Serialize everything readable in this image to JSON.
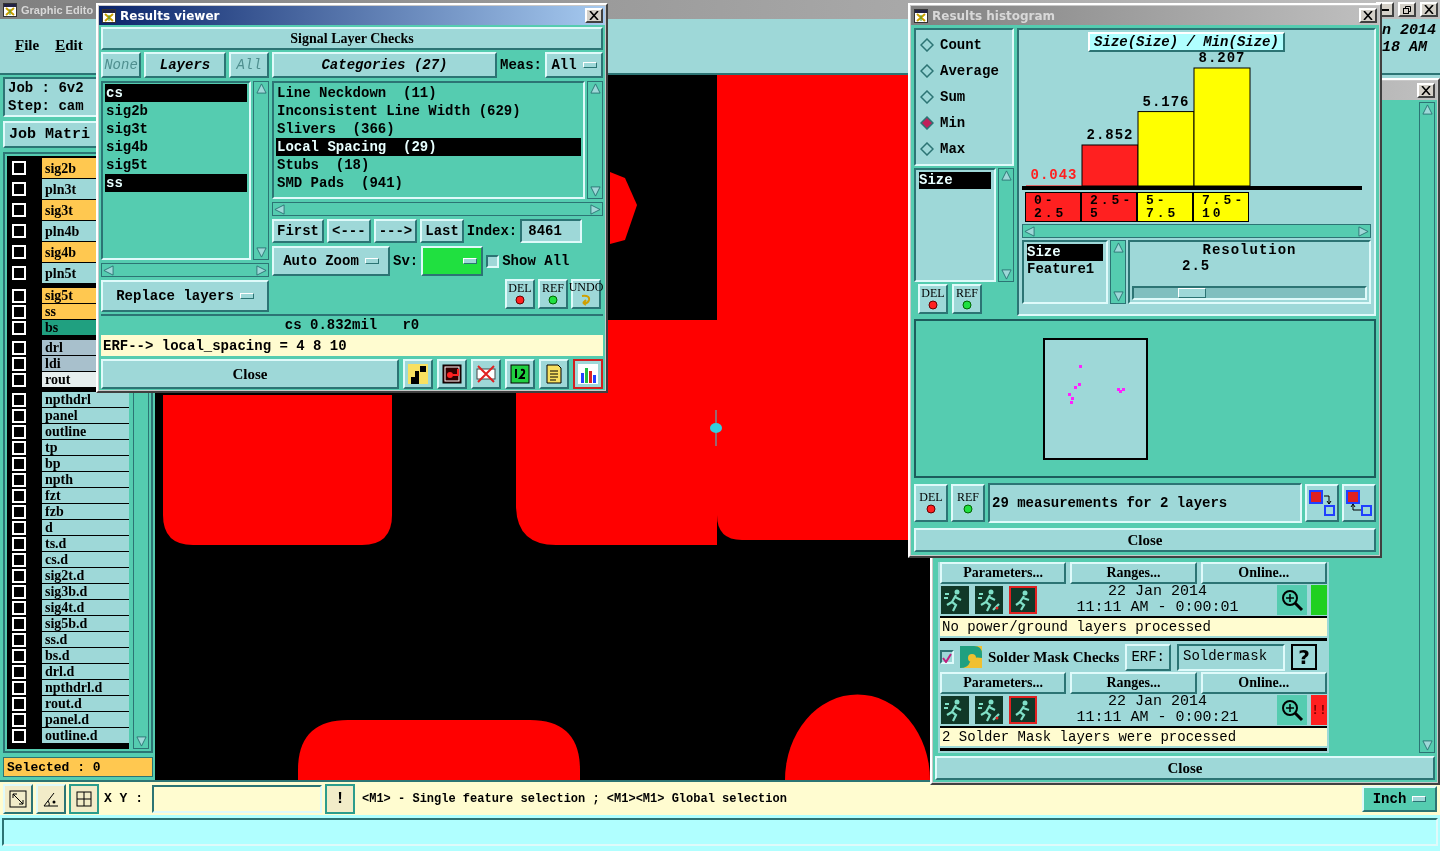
{
  "editor": {
    "title": "Graphic Edito",
    "menu": [
      {
        "label": "File"
      },
      {
        "label": "Edit"
      }
    ],
    "clock": [
      "n 2014",
      "18 AM"
    ],
    "job": "Job  :  6v2",
    "step": "Step:  cam",
    "job_matrix": "Job Matri",
    "layer_groups": [
      {
        "layers": [
          {
            "name": "sig2b",
            "color": "#ffc850",
            "checked": false
          },
          {
            "name": "pln3t",
            "color": "#9ed8d8",
            "checked": false
          },
          {
            "name": "sig3t",
            "color": "#ffc850",
            "checked": false
          },
          {
            "name": "pln4b",
            "color": "#9ed8d8",
            "checked": false
          },
          {
            "name": "sig4b",
            "color": "#ffc850",
            "checked": false
          },
          {
            "name": "pln5t",
            "color": "#9ed8d8",
            "checked": false
          }
        ]
      },
      {
        "layers": [
          {
            "name": "sig5t",
            "color": "#ffc850",
            "checked": false
          },
          {
            "name": "ss",
            "color": "#ffc850",
            "checked": false
          },
          {
            "name": "bs",
            "color": "#20a080",
            "checked": false
          }
        ]
      },
      {
        "layers": [
          {
            "name": "drl",
            "color": "#a8c0cc",
            "checked": false
          },
          {
            "name": "ldi",
            "color": "#a8c0cc",
            "checked": false
          },
          {
            "name": "rout",
            "color": "#e6eeee",
            "checked": false
          }
        ]
      },
      {
        "layers": [
          {
            "name": "npthdrl",
            "color": "#9ed8d8",
            "checked": false
          },
          {
            "name": "panel",
            "color": "#9ed8d8",
            "checked": false
          },
          {
            "name": "outline",
            "color": "#9ed8d8",
            "checked": false
          },
          {
            "name": "tp",
            "color": "#9ed8d8",
            "checked": false
          },
          {
            "name": "bp",
            "color": "#9ed8d8",
            "checked": false
          },
          {
            "name": "npth",
            "color": "#9ed8d8",
            "checked": false
          },
          {
            "name": "fzt",
            "color": "#9ed8d8",
            "checked": false
          },
          {
            "name": "fzb",
            "color": "#9ed8d8",
            "checked": false
          },
          {
            "name": "d",
            "color": "#9ed8d8",
            "checked": false
          },
          {
            "name": "ts.d",
            "color": "#9ed8d8",
            "checked": false
          },
          {
            "name": "cs.d",
            "color": "#9ed8d8",
            "checked": false
          },
          {
            "name": "sig2t.d",
            "color": "#9ed8d8",
            "checked": false
          },
          {
            "name": "sig3b.d",
            "color": "#9ed8d8",
            "checked": false
          },
          {
            "name": "sig4t.d",
            "color": "#9ed8d8",
            "checked": false
          },
          {
            "name": "sig5b.d",
            "color": "#9ed8d8",
            "checked": false
          },
          {
            "name": "ss.d",
            "color": "#9ed8d8",
            "checked": false
          },
          {
            "name": "bs.d",
            "color": "#9ed8d8",
            "checked": false
          },
          {
            "name": "drl.d",
            "color": "#9ed8d8",
            "checked": false
          },
          {
            "name": "npthdrl.d",
            "color": "#9ed8d8",
            "checked": false
          },
          {
            "name": "rout.d",
            "color": "#9ed8d8",
            "checked": false
          },
          {
            "name": "panel.d",
            "color": "#9ed8d8",
            "checked": false
          },
          {
            "name": "outline.d",
            "color": "#9ed8d8",
            "checked": false
          }
        ]
      }
    ],
    "selected_count": "Selected : 0",
    "xy_label": "X Y :",
    "alert_button": "!",
    "hint": "<M1> - Single feature selection ; <M1><M1> Global selection",
    "units": "Inch"
  },
  "results_viewer": {
    "title": "Results viewer",
    "check_name": "Signal Layer Checks",
    "layer_buttons": [
      {
        "label": "None",
        "disabled": true
      },
      {
        "label": "Layers",
        "disabled": false
      },
      {
        "label": "All",
        "disabled": true
      }
    ],
    "layers": [
      {
        "name": "cs",
        "selected": true
      },
      {
        "name": "sig2b",
        "selected": false
      },
      {
        "name": "sig3t",
        "selected": false
      },
      {
        "name": "sig4b",
        "selected": false
      },
      {
        "name": "sig5t",
        "selected": false
      },
      {
        "name": "ss",
        "selected": true
      }
    ],
    "replace_mode": "Replace layers",
    "categories_title": "Categories  (27)",
    "meas_label": "Meas:",
    "meas_value": "All",
    "categories": [
      {
        "label": "Line Neckdown  (11)",
        "selected": false
      },
      {
        "label": "Inconsistent Line Width (629)",
        "selected": false
      },
      {
        "label": "Slivers  (366)",
        "selected": false
      },
      {
        "label": "Local Spacing  (29)",
        "selected": true
      },
      {
        "label": "Stubs  (18)",
        "selected": false
      },
      {
        "label": "SMD Pads  (941)",
        "selected": false
      }
    ],
    "nav": [
      "First",
      "<---",
      "--->",
      "Last"
    ],
    "index_label": "Index:",
    "index_value": "8461",
    "zoom_mode": "Auto Zoom",
    "sv_label": "Sv:",
    "show_all": {
      "label": "Show All",
      "checked": false
    },
    "tool_buttons": [
      "DEL",
      "REF",
      "UNDO"
    ],
    "status": "cs 0.832mil   r0",
    "erf_line": "ERF--> local_spacing = 4 8 10",
    "close": "Close",
    "view_tools": [
      {
        "selected": false
      },
      {
        "selected": false
      },
      {
        "selected": false
      },
      {
        "selected": false
      },
      {
        "selected": false
      },
      {
        "selected": true
      }
    ]
  },
  "histogram": {
    "title": "Results histogram",
    "functions": [
      {
        "label": "Count",
        "selected": false
      },
      {
        "label": "Average",
        "selected": false
      },
      {
        "label": "Sum",
        "selected": false
      },
      {
        "label": "Min",
        "selected": true
      },
      {
        "label": "Max",
        "selected": false
      }
    ],
    "attributes": [
      {
        "label": "Size",
        "selected": true
      }
    ],
    "tool_buttons": [
      "DEL",
      "REF"
    ],
    "chart_data": {
      "type": "bar",
      "title": "Size(Size) / Min(Size)",
      "categories": [
        "0-2.5",
        "2.5-5",
        "5-7.5",
        "7.5-10"
      ],
      "values": [
        0.043,
        2.852,
        5.176,
        8.207
      ],
      "data_labels": true
    },
    "bins": [
      {
        "color": "#ff2020"
      },
      {
        "color": "#ff2020"
      },
      {
        "color": "#ffff00"
      },
      {
        "color": "#ffff00"
      }
    ],
    "fields": [
      {
        "label": "Size",
        "selected": true
      },
      {
        "label": "Feature1",
        "selected": false
      }
    ],
    "resolution_label": "Resolution",
    "resolution_value": "2.5",
    "resolution_slider": {
      "level": 0.25
    },
    "map_buttons": [
      "DEL",
      "REF"
    ],
    "summary": "29 measurements for 2 layers",
    "close": "Close"
  },
  "checks_window": {
    "checks": [
      {
        "buttons": [
          "Parameters...",
          "Ranges...",
          "Online..."
        ],
        "date": "22 Jan 2014",
        "time": "11:11 AM - 0:00:01",
        "color": "#20d020",
        "message": "No power/ground layers processed"
      },
      {
        "checked": true,
        "title": "Solder Mask Checks",
        "erf_label": "ERF:",
        "erf_value": "Soldermask",
        "help": "?",
        "buttons": [
          "Parameters...",
          "Ranges...",
          "Online..."
        ],
        "date": "22 Jan 2014",
        "time": "11:11 AM - 0:00:21",
        "color": "#ff2020",
        "status_mark": "!!",
        "message": "2 Solder Mask layers were processed"
      }
    ],
    "close": "Close"
  }
}
